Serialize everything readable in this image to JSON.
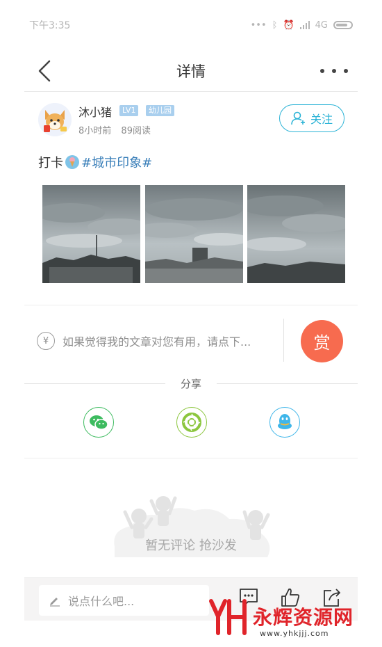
{
  "status_bar": {
    "time": "下午3:35",
    "network": "4G"
  },
  "nav": {
    "title": "详情"
  },
  "author": {
    "name": "沐小猪",
    "level_badge": "LV1",
    "group_badge": "幼儿园",
    "time_ago": "8小时前",
    "read_count": "89阅读",
    "follow_label": "关注"
  },
  "post": {
    "text_prefix": "打卡",
    "hashtag": "#城市印象#",
    "photo_count": 3
  },
  "reward": {
    "currency_symbol": "¥",
    "prompt": "如果觉得我的文章对您有用，请点下...",
    "button_label": "赏",
    "button_color": "#f76b4f"
  },
  "share": {
    "label": "分享",
    "targets": [
      {
        "icon": "wechat-icon",
        "color": "#3dbb5f"
      },
      {
        "icon": "moments-icon",
        "color": "#8cc63e"
      },
      {
        "icon": "qq-icon",
        "color": "#3fb6e9"
      }
    ]
  },
  "comments": {
    "empty_text": "暂无评论 抢沙发"
  },
  "bottom_bar": {
    "comment_placeholder": "说点什么吧...",
    "actions": [
      "comment-icon",
      "like-icon",
      "share-icon"
    ]
  },
  "watermark": {
    "text": "永辉资源网",
    "url": "www.yhkjjj.com"
  },
  "accent_color": "#2bb3d6"
}
